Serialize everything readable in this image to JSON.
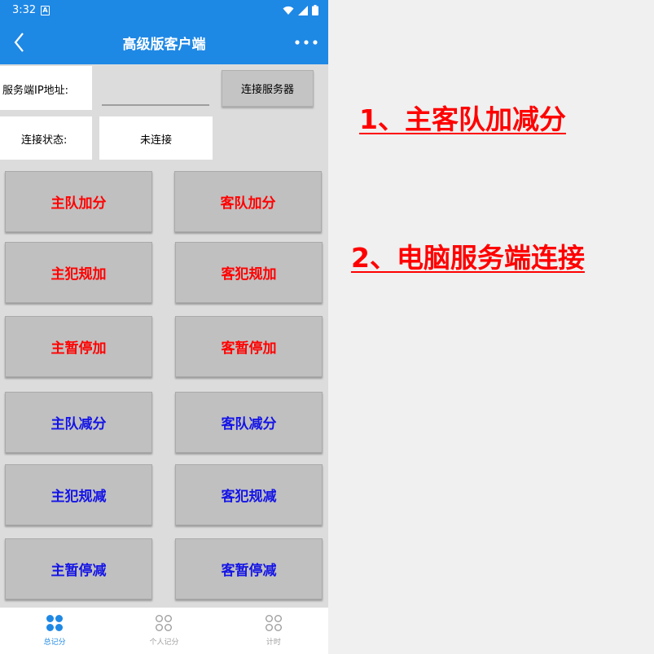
{
  "status_bar": {
    "time": "3:32",
    "notification_icon": "a-notification-icon",
    "icons": [
      "wifi-icon",
      "signal-icon",
      "battery-icon"
    ]
  },
  "app_bar": {
    "title": "高级版客户端",
    "back_icon": "back-chevron-icon",
    "more_icon": "more-dots-icon",
    "color": "#1e88e5"
  },
  "server": {
    "ip_label": "服务端IP地址:",
    "ip_value": "",
    "connect_button": "连接服务器",
    "status_label": "连接状态:",
    "status_value": "未连接"
  },
  "score_buttons": [
    {
      "label": "主队加分",
      "color": "red"
    },
    {
      "label": "客队加分",
      "color": "red"
    },
    {
      "label": "主犯规加",
      "color": "red"
    },
    {
      "label": "客犯规加",
      "color": "red"
    },
    {
      "label": "主暂停加",
      "color": "red"
    },
    {
      "label": "客暂停加",
      "color": "red"
    },
    {
      "label": "主队减分",
      "color": "blue"
    },
    {
      "label": "客队减分",
      "color": "blue"
    },
    {
      "label": "主犯规减",
      "color": "blue"
    },
    {
      "label": "客犯规减",
      "color": "blue"
    },
    {
      "label": "主暂停减",
      "color": "blue"
    },
    {
      "label": "客暂停减",
      "color": "blue"
    }
  ],
  "bottom_nav": [
    {
      "label": "总记分",
      "icon": "four-dots-grid-icon",
      "active": true
    },
    {
      "label": "个人记分",
      "icon": "four-circles-grid-icon",
      "active": false
    },
    {
      "label": "计时",
      "icon": "four-circles-grid-icon",
      "active": false
    }
  ],
  "annotations": [
    "1、主客队加减分",
    "2、电脑服务端连接"
  ],
  "colors": {
    "accent": "#1e88e5",
    "add_text": "#ff0000",
    "subtract_text": "#1414e6",
    "annotation": "#ff0000",
    "nav_active": "#1e88e5",
    "nav_inactive": "#9e9e9e"
  }
}
